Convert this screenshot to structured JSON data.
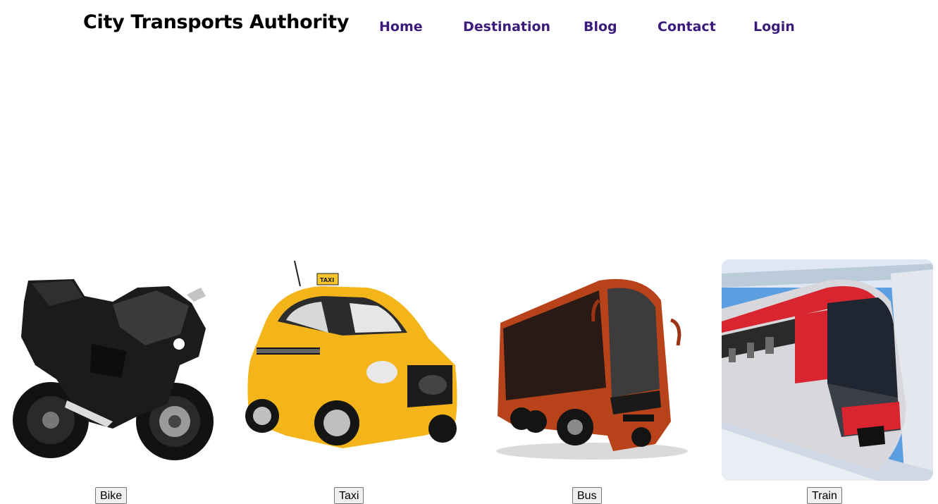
{
  "header": {
    "brand": "City Transports Authority",
    "nav": [
      {
        "label": "Home"
      },
      {
        "label": "Destination"
      },
      {
        "label": "Blog"
      },
      {
        "label": "Contact"
      },
      {
        "label": "Login"
      }
    ]
  },
  "vehicles": [
    {
      "label": "Bike",
      "image": "motorcycle-image"
    },
    {
      "label": "Taxi",
      "image": "taxi-image",
      "sign": "TAXI"
    },
    {
      "label": "Bus",
      "image": "bus-image"
    },
    {
      "label": "Train",
      "image": "train-image"
    }
  ],
  "colors": {
    "nav_text": "#3b1a7a",
    "taxi_yellow": "#f3b51a",
    "bus_orange": "#b8431b",
    "train_red": "#d8252f"
  }
}
